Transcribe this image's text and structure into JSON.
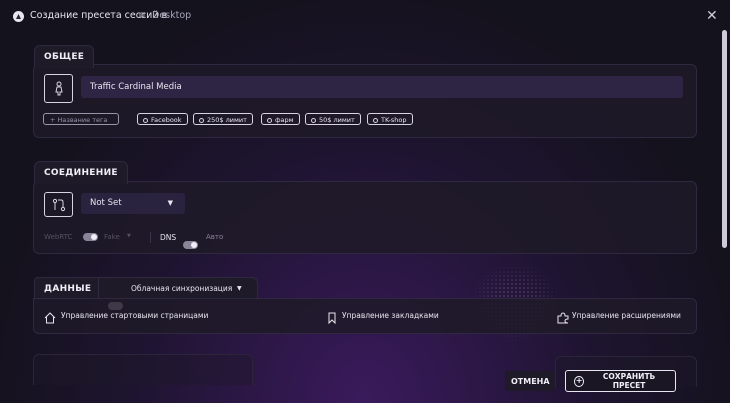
{
  "window": {
    "title": "Создание пресета сессий в",
    "workspace": "Desktop",
    "close": "✕"
  },
  "general": {
    "tab": "ОБЩЕЕ",
    "name_value": "Traffic Cardinal Media",
    "tag_add_label": "+ Название тега",
    "tags": [
      "Facebook",
      "250$ лимит",
      "фарм",
      "50$ лимит",
      "TK-shop"
    ]
  },
  "connection": {
    "tab": "СОЕДИНЕНИЕ",
    "proxy_select": "Not Set",
    "webrtc_label": "WebRTC",
    "webrtc_value": "Fake",
    "dns_label": "DNS",
    "dns_value": "Авто"
  },
  "data": {
    "tab": "ДАННЫЕ",
    "sync_label": "Облачная синхронизация",
    "start_pages": "Управление стартовыми страницами",
    "bookmarks": "Управление закладками",
    "extensions": "Управление расширениями"
  },
  "footer": {
    "cancel": "ОТМЕНА",
    "save": "СОХРАНИТЬ ПРЕСЕТ"
  },
  "colors": {
    "background": "#14121c",
    "accent_purple": "#3a1a5c",
    "input_bg": "#2e2545"
  }
}
